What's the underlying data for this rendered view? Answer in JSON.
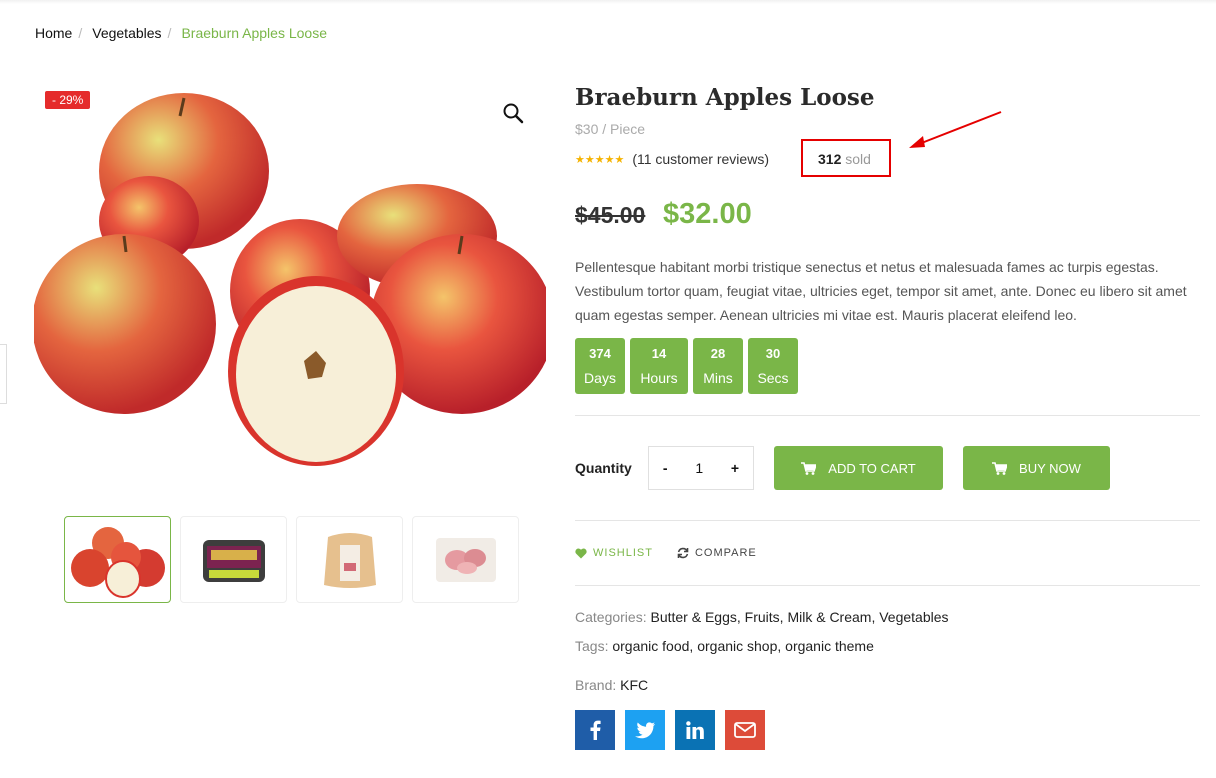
{
  "breadcrumb": {
    "home": "Home",
    "category": "Vegetables",
    "current": "Braeburn Apples Loose",
    "separator": "/"
  },
  "gallery": {
    "discount_badge": "- 29%",
    "zoom_icon": "search-icon",
    "thumbnails": [
      "Apples",
      "Plums",
      "Pork pack",
      "Meat tray"
    ]
  },
  "product": {
    "title": "Braeburn Apples Loose",
    "unit_price": "$30 / Piece",
    "rating_stars": "★★★★★",
    "reviews": "(11 customer reviews)",
    "sold_count": "312",
    "sold_label": "sold",
    "old_price": "$45.00",
    "new_price": "$32.00",
    "description": "Pellentesque habitant morbi tristique senectus et netus et malesuada fames ac turpis egestas. Vestibulum tortor quam, feugiat vitae, ultricies eget, tempor sit amet, ante. Donec eu libero sit amet quam egestas semper. Aenean ultricies mi vitae est. Mauris placerat eleifend leo."
  },
  "countdown": [
    {
      "value": "374",
      "label": "Days"
    },
    {
      "value": "14",
      "label": "Hours"
    },
    {
      "value": "28",
      "label": "Mins"
    },
    {
      "value": "30",
      "label": "Secs"
    }
  ],
  "purchase": {
    "quantity_label": "Quantity",
    "minus": "-",
    "quantity": "1",
    "plus": "+",
    "add_to_cart": "ADD TO CART",
    "buy_now": "BUY NOW"
  },
  "actions": {
    "wishlist": "WISHLIST",
    "compare": "COMPARE"
  },
  "meta": {
    "categories_label": "Categories:",
    "categories": [
      "Butter & Eggs",
      "Fruits",
      "Milk & Cream",
      "Vegetables"
    ],
    "tags_label": "Tags:",
    "tags": [
      "organic food",
      "organic shop",
      "organic theme"
    ],
    "brand_label": "Brand:",
    "brand": "KFC"
  },
  "social": [
    {
      "name": "facebook",
      "glyph": "f",
      "color": "#1f5da8"
    },
    {
      "name": "twitter",
      "glyph": "t",
      "color": "#1da1f2"
    },
    {
      "name": "linkedin",
      "glyph": "in",
      "color": "#0a72b4"
    },
    {
      "name": "email",
      "glyph": "✉",
      "color": "#dd4b39"
    }
  ],
  "colors": {
    "accent": "#7ab648",
    "sale": "#e52b2b",
    "highlight": "#e50000"
  }
}
